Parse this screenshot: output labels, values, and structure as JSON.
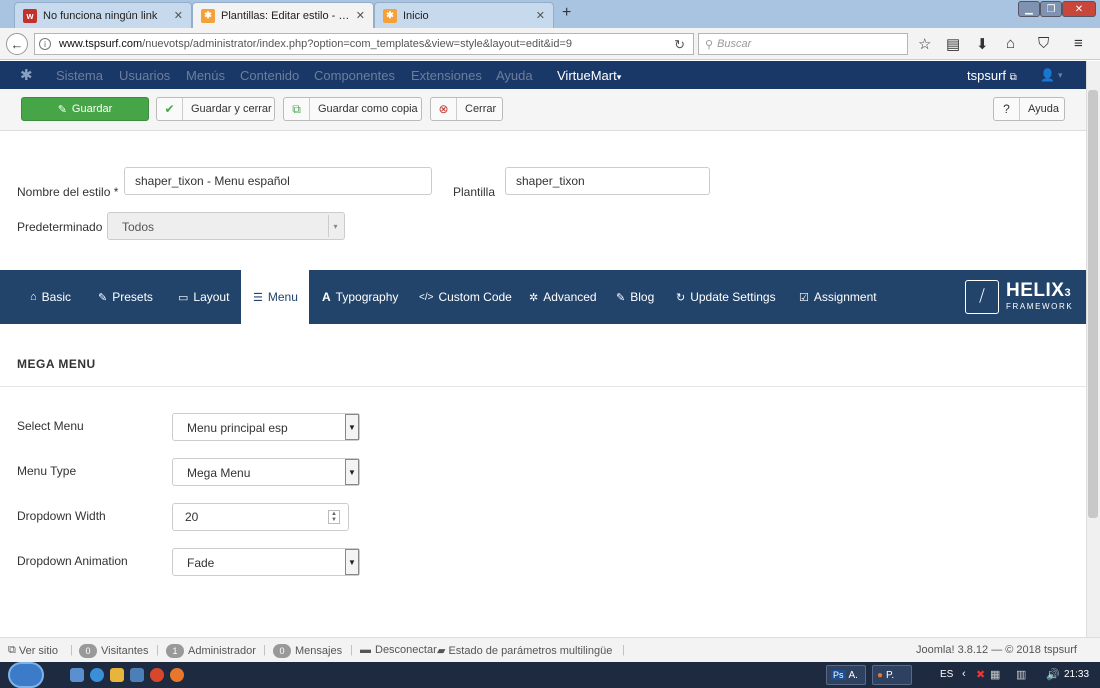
{
  "browser": {
    "tabs": [
      {
        "label": "No funciona ningún link",
        "icon": "w-favicon"
      },
      {
        "label": "Plantillas: Editar estilo - tsp...",
        "icon": "joomla-favicon"
      },
      {
        "label": "Inicio",
        "icon": "joomla-favicon"
      }
    ],
    "url_host": "www.tspsurf.com",
    "url_path": "/nuevotsp/administrator/index.php?option=com_templates&view=style&layout=edit&id=9",
    "search_placeholder": "Buscar"
  },
  "admin_menu": {
    "items": [
      "Sistema",
      "Usuarios",
      "Menús",
      "Contenido",
      "Componentes",
      "Extensiones",
      "Ayuda"
    ],
    "virtuemart": "VirtueMart",
    "site_link": "tspsurf"
  },
  "toolbar": {
    "save": "Guardar",
    "save_close": "Guardar y cerrar",
    "save_copy": "Guardar como copia",
    "close": "Cerrar",
    "help": "Ayuda"
  },
  "form": {
    "style_name_label": "Nombre del estilo *",
    "style_name_value": "shaper_tixon - Menu español",
    "template_label": "Plantilla",
    "template_value": "shaper_tixon",
    "default_label": "Predeterminado",
    "default_value": "Todos"
  },
  "helix_tabs": [
    {
      "label": "Basic",
      "icon": "home-icon"
    },
    {
      "label": "Presets",
      "icon": "brush-icon"
    },
    {
      "label": "Layout",
      "icon": "layout-icon"
    },
    {
      "label": "Menu",
      "icon": "list-icon"
    },
    {
      "label": "Typography",
      "icon": "font-icon"
    },
    {
      "label": "Custom Code",
      "icon": "code-icon"
    },
    {
      "label": "Advanced",
      "icon": "gear-icon"
    },
    {
      "label": "Blog",
      "icon": "pin-icon"
    },
    {
      "label": "Update Settings",
      "icon": "refresh-icon"
    },
    {
      "label": "Assignment",
      "icon": "check-square-icon"
    }
  ],
  "helix_logo": {
    "name": "HELIX",
    "version": "3",
    "sub": "FRAMEWORK"
  },
  "mega_menu": {
    "title": "MEGA MENU",
    "select_menu_label": "Select Menu",
    "select_menu_value": "Menu principal esp",
    "menu_type_label": "Menu Type",
    "menu_type_value": "Mega Menu",
    "dropdown_width_label": "Dropdown Width",
    "dropdown_width_value": "20",
    "dropdown_animation_label": "Dropdown Animation",
    "dropdown_animation_value": "Fade"
  },
  "status": {
    "view_site": "Ver sitio",
    "visitors_count": "0",
    "visitors": "Visitantes",
    "admin_count": "1",
    "admin": "Administrador",
    "messages_count": "0",
    "messages": "Mensajes",
    "logout": "Desconectar",
    "multilang": "Estado de parámetros multilingüe",
    "version": "Joomla! 3.8.12 — © 2018 tspsurf"
  },
  "taskbar": {
    "task1": "A.",
    "task2": "P.",
    "lang": "ES",
    "time": "21:33"
  },
  "colors": {
    "admin_header": "#1a3867",
    "helix_bar": "#22446b",
    "save_green": "#46a546"
  }
}
